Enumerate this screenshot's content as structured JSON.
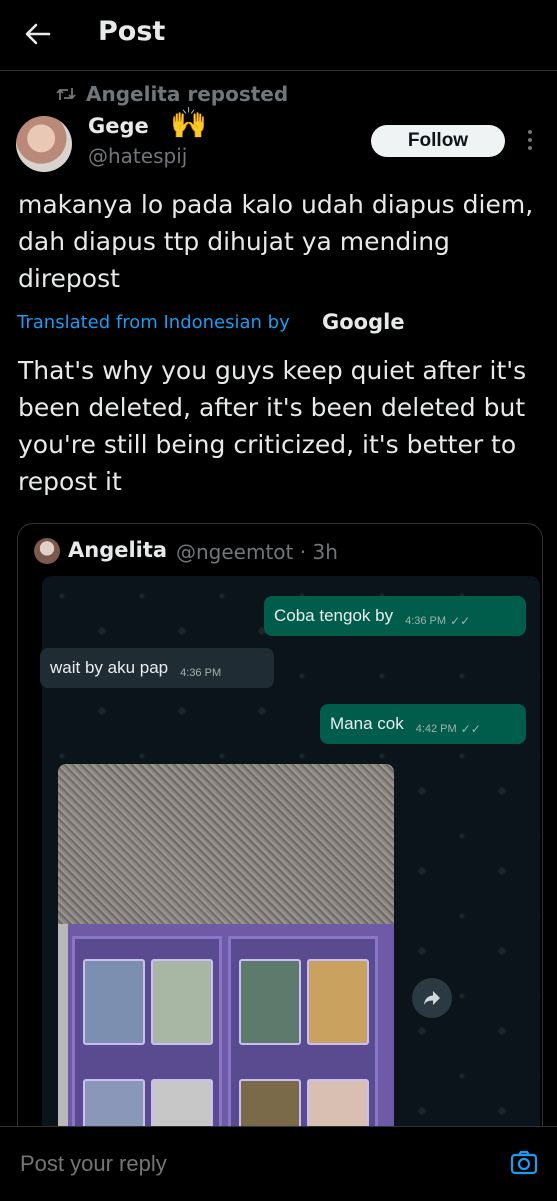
{
  "header": {
    "title": "Post"
  },
  "post": {
    "repost_label": "Angelita reposted",
    "author_name": "Gege",
    "author_emoji": "🙌",
    "author_handle": "@hatespij",
    "follow_label": "Follow",
    "text": "makanya lo pada kalo udah diapus diem, dah diapus ttp dihujat ya mending direpost",
    "translated_label": "Translated from Indonesian by",
    "translator": "Google",
    "translation": "That's why you guys keep quiet after it's been deleted, after it's been deleted but you're still being criticized, it's better to repost it"
  },
  "quote": {
    "author_name": "Angelita",
    "author_handle": "@ngeemtot",
    "time": "· 3h",
    "chat": [
      {
        "text": "Coba tengok by",
        "time": "4:36 PM",
        "ticks": "✓✓",
        "direction": "outgoing"
      },
      {
        "text": "wait by aku pap",
        "time": "4:36 PM",
        "ticks": "",
        "direction": "incoming"
      },
      {
        "text": "Mana cok",
        "time": "4:42 PM",
        "ticks": "✓✓",
        "direction": "outgoing"
      }
    ]
  },
  "reply": {
    "placeholder": "Post your reply"
  },
  "colors": {
    "background": "#000000",
    "accent": "#1d9bf0",
    "outgoing_bubble": "#005c4b",
    "incoming_bubble": "#202c33",
    "muted": "#71767b"
  },
  "icons": {
    "back": "back-arrow-icon",
    "repost": "repost-icon",
    "more": "more-icon",
    "share": "forward-icon",
    "camera": "camera-icon"
  }
}
